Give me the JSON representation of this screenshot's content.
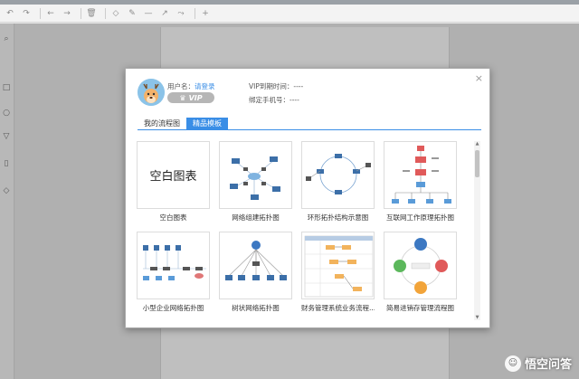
{
  "user": {
    "name_label": "用户名：",
    "login_link": "请登录",
    "vip_badge": "VIP",
    "vip_expire": "VIP到期时间：----",
    "phone": "绑定手机号：----"
  },
  "tabs": [
    {
      "label": "我的流程图",
      "active": false
    },
    {
      "label": "精品模板",
      "active": true
    }
  ],
  "templates": [
    {
      "label": "空白图表",
      "thumb_text": "空白图表"
    },
    {
      "label": "网络组建拓扑图"
    },
    {
      "label": "环形拓扑结构示意图"
    },
    {
      "label": "互联网工作原理拓扑图"
    },
    {
      "label": "小型企业网络拓扑图"
    },
    {
      "label": "树状网络拓扑图"
    },
    {
      "label": "财务管理系统业务流程..."
    },
    {
      "label": "简易进销存管理流程图"
    }
  ],
  "close_glyph": "×",
  "watermark": "悟空问答",
  "colors": {
    "accent": "#3a8ee6",
    "vip_badge": "#b6b6b6"
  }
}
